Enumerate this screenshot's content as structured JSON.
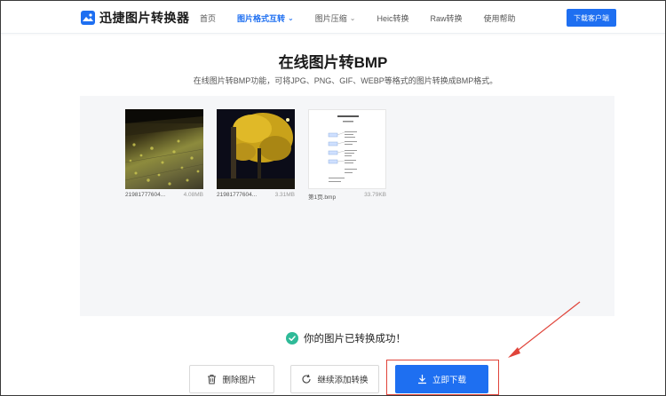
{
  "header": {
    "logo_text": "迅捷图片转换器",
    "nav": [
      {
        "label": "首页",
        "active": false,
        "has_dropdown": false
      },
      {
        "label": "图片格式互转",
        "active": true,
        "has_dropdown": true
      },
      {
        "label": "图片压缩",
        "active": false,
        "has_dropdown": true
      },
      {
        "label": "Heic转换",
        "active": false,
        "has_dropdown": false
      },
      {
        "label": "Raw转换",
        "active": false,
        "has_dropdown": false
      },
      {
        "label": "使用帮助",
        "active": false,
        "has_dropdown": false
      }
    ],
    "download_client_label": "下载客户端"
  },
  "page": {
    "title": "在线图片转BMP",
    "subtitle": "在线图片转BMP功能，可将JPG、PNG、GIF、WEBP等格式的图片转换成BMP格式。"
  },
  "files": [
    {
      "name": "21981777604...",
      "size": "4.08MB"
    },
    {
      "name": "21981777604...",
      "size": "3.31MB"
    },
    {
      "name": "第1页.bmp",
      "size": "33.79KB"
    }
  ],
  "status": {
    "success_text": "你的图片已转换成功！"
  },
  "actions": {
    "delete_label": "删除图片",
    "continue_label": "继续添加转换",
    "download_label": "立即下载"
  },
  "colors": {
    "accent": "#1e6ff1",
    "success": "#2fba98",
    "annotation": "#e0443a"
  }
}
